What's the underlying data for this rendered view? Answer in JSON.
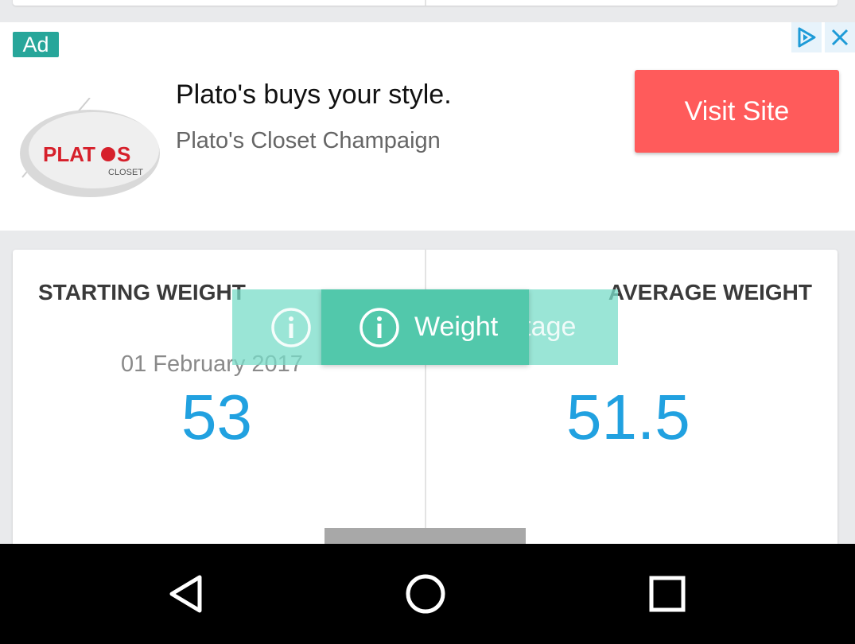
{
  "ad": {
    "badge": "Ad",
    "headline": "Plato's buys your style.",
    "advertiser": "Plato's Closet Champaign",
    "cta": "Visit Site",
    "logo_text": "PLATO'S",
    "logo_subtext": "CLOSET"
  },
  "stats": {
    "starting_label": "STARTING WEIGHT",
    "starting_date": "01 February 2017",
    "starting_value": "53",
    "average_label": "AVERAGE WEIGHT",
    "average_value": "51.5"
  },
  "tabs": {
    "active_label": "Weight",
    "behind_label": "Body Fat Percentage"
  },
  "colors": {
    "accent_value": "#21a1e0",
    "tab_active": "#52c8ab",
    "ad_badge": "#27a69a",
    "cta": "#ff5b5b"
  },
  "icons": {
    "tab": "info-icon",
    "adchoices": "adchoices-icon",
    "close": "close-icon",
    "nav_back": "back-triangle-icon",
    "nav_home": "home-circle-icon",
    "nav_recents": "recents-square-icon"
  }
}
